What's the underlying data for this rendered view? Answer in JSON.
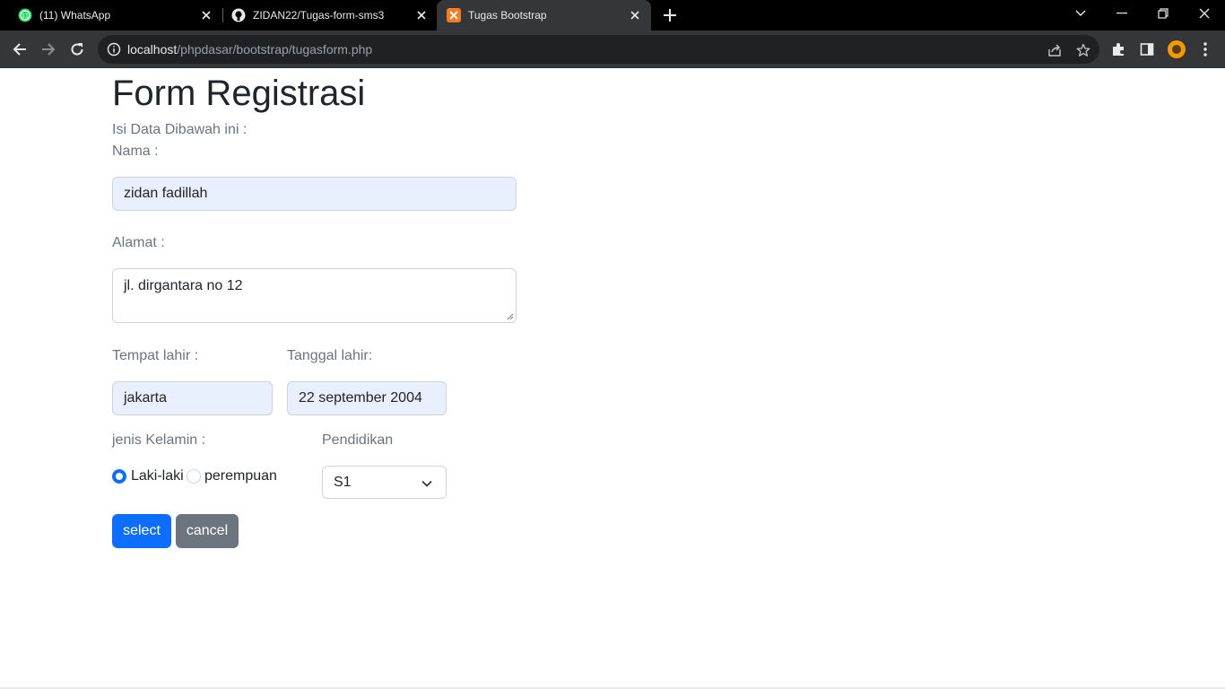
{
  "browser": {
    "tabs": [
      {
        "title": "(11) WhatsApp",
        "icon": "whatsapp-icon",
        "active": false
      },
      {
        "title": "ZIDAN22/Tugas-form-sms3",
        "icon": "github-icon",
        "active": false
      },
      {
        "title": "Tugas Bootstrap",
        "icon": "xampp-icon",
        "active": true
      }
    ],
    "url_host": "localhost",
    "url_path": "/phpdasar/bootstrap/tugasform.php"
  },
  "form": {
    "title": "Form Registrasi",
    "subtitle": "Isi Data Dibawah ini :",
    "nama_label": "Nama :",
    "nama_value": "zidan fadillah",
    "alamat_label": "Alamat :",
    "alamat_value": "jl. dirgantara no 12",
    "tempat_label": "Tempat lahir :",
    "tempat_value": "jakarta",
    "tanggal_label": "Tanggal lahir:",
    "tanggal_value": "22 september 2004",
    "gender_label": "jenis Kelamin :",
    "gender_options": [
      {
        "label": "Laki-laki",
        "checked": true
      },
      {
        "label": "perempuan",
        "checked": false
      }
    ],
    "pendidikan_label": "Pendidikan",
    "pendidikan_value": "S1",
    "submit_label": "select",
    "cancel_label": "cancel"
  },
  "colors": {
    "primary": "#0d6efd",
    "secondary": "#6c757d",
    "autofill": "#e8f0fe"
  }
}
